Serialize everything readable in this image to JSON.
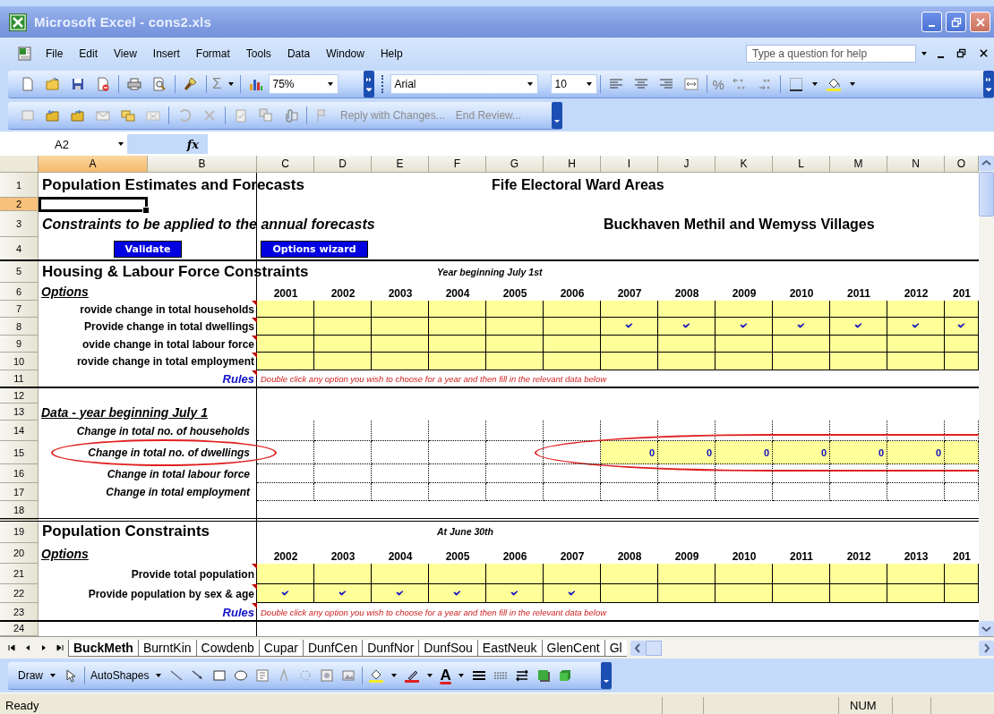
{
  "window": {
    "title": "Microsoft Excel - cons2.xls"
  },
  "menu": [
    "File",
    "Edit",
    "View",
    "Insert",
    "Format",
    "Tools",
    "Data",
    "Window",
    "Help"
  ],
  "help_box": {
    "placeholder": "Type a question for help"
  },
  "formatting": {
    "sum_glyph": "Σ",
    "zoom": "75%",
    "font": "Arial",
    "size": "10",
    "percent_glyph": "%"
  },
  "review_toolbar": [
    {
      "label": "Reply with Changes...",
      "disabled": true
    },
    {
      "label": "End Review...",
      "disabled": true
    }
  ],
  "formula_bar": {
    "name_box": "A2",
    "fx": "fx"
  },
  "columns": [
    {
      "label": "A",
      "selected": true
    },
    {
      "label": "B",
      "selected": false
    },
    {
      "label": "C",
      "selected": false
    },
    {
      "label": "D",
      "selected": false
    },
    {
      "label": "E",
      "selected": false
    },
    {
      "label": "F",
      "selected": false
    },
    {
      "label": "G",
      "selected": false
    },
    {
      "label": "H",
      "selected": false
    },
    {
      "label": "I",
      "selected": false
    },
    {
      "label": "J",
      "selected": false
    },
    {
      "label": "K",
      "selected": false
    },
    {
      "label": "L",
      "selected": false
    },
    {
      "label": "M",
      "selected": false
    },
    {
      "label": "N",
      "selected": false
    },
    {
      "label": "O",
      "selected": false
    }
  ],
  "rows": [
    {
      "n": "1",
      "selected": false,
      "items": [
        {
          "kind": "title",
          "text": "Population Estimates and Forecasts"
        },
        {
          "kind": "heading",
          "text": "Fife Electoral Ward Areas"
        }
      ]
    },
    {
      "n": "2",
      "selected": true
    },
    {
      "n": "3",
      "selected": false,
      "items": [
        {
          "kind": "subtitle",
          "text": "Constraints to be applied to the annual forecasts"
        },
        {
          "kind": "area",
          "text": "Buckhaven Methil and Wemyss Villages"
        }
      ]
    },
    {
      "n": "4",
      "selected": false,
      "rule_below": true,
      "items": [
        {
          "kind": "button",
          "text": "Validate"
        },
        {
          "kind": "button",
          "text": "Options wizard"
        }
      ]
    },
    {
      "n": "5",
      "selected": false,
      "items": [
        {
          "kind": "title",
          "text": "Housing & Labour Force Constraints"
        },
        {
          "kind": "note",
          "text": "Year beginning July 1st"
        }
      ]
    },
    {
      "n": "6",
      "selected": false,
      "items": [
        {
          "kind": "section",
          "text": "Options"
        }
      ],
      "years": [
        "2001",
        "2002",
        "2003",
        "2004",
        "2005",
        "2006",
        "2007",
        "2008",
        "2009",
        "2010",
        "2011",
        "2012",
        "201"
      ]
    },
    {
      "n": "7",
      "selected": false,
      "items": [
        {
          "kind": "label",
          "text": "rovide change in total households",
          "comment": true
        }
      ],
      "grid": {
        "kind": "input",
        "cells": [
          {
            "checked": false
          },
          {
            "checked": false
          },
          {
            "checked": false
          },
          {
            "checked": false
          },
          {
            "checked": false
          },
          {
            "checked": false
          },
          {
            "checked": false
          },
          {
            "checked": false
          },
          {
            "checked": false
          },
          {
            "checked": false
          },
          {
            "checked": false
          },
          {
            "checked": false
          },
          {
            "checked": false
          }
        ]
      }
    },
    {
      "n": "8",
      "selected": false,
      "items": [
        {
          "kind": "label",
          "text": "Provide change in total dwellings",
          "comment": true
        }
      ],
      "grid": {
        "kind": "input",
        "cells": [
          {
            "checked": false
          },
          {
            "checked": false
          },
          {
            "checked": false
          },
          {
            "checked": false
          },
          {
            "checked": false
          },
          {
            "checked": false
          },
          {
            "checked": true
          },
          {
            "checked": true
          },
          {
            "checked": true
          },
          {
            "checked": true
          },
          {
            "checked": true
          },
          {
            "checked": true
          },
          {
            "checked": true
          }
        ]
      }
    },
    {
      "n": "9",
      "selected": false,
      "items": [
        {
          "kind": "label",
          "text": "ovide change in total labour force",
          "comment": true
        }
      ],
      "grid": {
        "kind": "input",
        "cells": [
          {
            "checked": false
          },
          {
            "checked": false
          },
          {
            "checked": false
          },
          {
            "checked": false
          },
          {
            "checked": false
          },
          {
            "checked": false
          },
          {
            "checked": false
          },
          {
            "checked": false
          },
          {
            "checked": false
          },
          {
            "checked": false
          },
          {
            "checked": false
          },
          {
            "checked": false
          },
          {
            "checked": false
          }
        ]
      }
    },
    {
      "n": "10",
      "selected": false,
      "items": [
        {
          "kind": "label",
          "text": "rovide change in total employment",
          "comment": true
        }
      ],
      "grid": {
        "kind": "input",
        "cells": [
          {
            "checked": false
          },
          {
            "checked": false
          },
          {
            "checked": false
          },
          {
            "checked": false
          },
          {
            "checked": false
          },
          {
            "checked": false
          },
          {
            "checked": false
          },
          {
            "checked": false
          },
          {
            "checked": false
          },
          {
            "checked": false
          },
          {
            "checked": false
          },
          {
            "checked": false
          },
          {
            "checked": false
          }
        ]
      }
    },
    {
      "n": "11",
      "selected": false,
      "rule_below": true,
      "items": [
        {
          "kind": "rules",
          "text": "Rules",
          "comment": true
        },
        {
          "kind": "hint",
          "text": "Double click any option you wish to choose for a year and then fill in the relevant data below"
        }
      ]
    },
    {
      "n": "12",
      "selected": false
    },
    {
      "n": "13",
      "selected": false,
      "items": [
        {
          "kind": "section",
          "text": "Data - year beginning July 1"
        }
      ]
    },
    {
      "n": "14",
      "selected": false,
      "items": [
        {
          "kind": "data_label",
          "text": "Change in total no. of households"
        }
      ],
      "grid": {
        "kind": "data",
        "cells": [
          {
            "highlighted": false
          },
          {
            "highlighted": false
          },
          {
            "highlighted": false
          },
          {
            "highlighted": false
          },
          {
            "highlighted": false
          },
          {
            "highlighted": false
          },
          {
            "highlighted": false
          },
          {
            "highlighted": false
          },
          {
            "highlighted": false
          },
          {
            "highlighted": false
          },
          {
            "highlighted": false
          },
          {
            "highlighted": false
          },
          {
            "highlighted": false
          }
        ]
      }
    },
    {
      "n": "15",
      "selected": false,
      "items": [
        {
          "kind": "data_label",
          "text": "Change in total no. of dwellings",
          "circled": true
        }
      ],
      "grid": {
        "kind": "data",
        "circled": true,
        "cells": [
          {
            "highlighted": false
          },
          {
            "highlighted": false
          },
          {
            "highlighted": false
          },
          {
            "highlighted": false
          },
          {
            "highlighted": false
          },
          {
            "highlighted": false
          },
          {
            "highlighted": true,
            "value": "0"
          },
          {
            "highlighted": true,
            "value": "0"
          },
          {
            "highlighted": true,
            "value": "0"
          },
          {
            "highlighted": true,
            "value": "0"
          },
          {
            "highlighted": true,
            "value": "0"
          },
          {
            "highlighted": true,
            "value": "0"
          },
          {
            "highlighted": true
          }
        ]
      }
    },
    {
      "n": "16",
      "selected": false,
      "items": [
        {
          "kind": "data_label",
          "text": "Change in total labour force"
        }
      ],
      "grid": {
        "kind": "data",
        "cells": [
          {
            "highlighted": false
          },
          {
            "highlighted": false
          },
          {
            "highlighted": false
          },
          {
            "highlighted": false
          },
          {
            "highlighted": false
          },
          {
            "highlighted": false
          },
          {
            "highlighted": false
          },
          {
            "highlighted": false
          },
          {
            "highlighted": false
          },
          {
            "highlighted": false
          },
          {
            "highlighted": false
          },
          {
            "highlighted": false
          },
          {
            "highlighted": false
          }
        ]
      }
    },
    {
      "n": "17",
      "selected": false,
      "items": [
        {
          "kind": "data_label",
          "text": "Change in total employment"
        }
      ],
      "grid": {
        "kind": "data",
        "cells": [
          {
            "highlighted": false
          },
          {
            "highlighted": false
          },
          {
            "highlighted": false
          },
          {
            "highlighted": false
          },
          {
            "highlighted": false
          },
          {
            "highlighted": false
          },
          {
            "highlighted": false
          },
          {
            "highlighted": false
          },
          {
            "highlighted": false
          },
          {
            "highlighted": false
          },
          {
            "highlighted": false
          },
          {
            "highlighted": false
          },
          {
            "highlighted": false
          }
        ]
      }
    },
    {
      "n": "18",
      "selected": false,
      "double_rule_below": true
    },
    {
      "n": "19",
      "selected": false,
      "items": [
        {
          "kind": "title",
          "text": "Population Constraints"
        },
        {
          "kind": "note",
          "text": "At June 30th"
        }
      ]
    },
    {
      "n": "20",
      "selected": false,
      "items": [
        {
          "kind": "section",
          "text": "Options"
        }
      ],
      "years": [
        "2002",
        "2003",
        "2004",
        "2005",
        "2006",
        "2007",
        "2008",
        "2009",
        "2010",
        "2011",
        "2012",
        "2013",
        "201"
      ]
    },
    {
      "n": "21",
      "selected": false,
      "items": [
        {
          "kind": "label",
          "text": "Provide total population",
          "comment": true
        }
      ],
      "grid": {
        "kind": "input",
        "cells": [
          {
            "checked": false
          },
          {
            "checked": false
          },
          {
            "checked": false
          },
          {
            "checked": false
          },
          {
            "checked": false
          },
          {
            "checked": false
          },
          {
            "checked": false
          },
          {
            "checked": false
          },
          {
            "checked": false
          },
          {
            "checked": false
          },
          {
            "checked": false
          },
          {
            "checked": false
          },
          {
            "checked": false
          }
        ]
      }
    },
    {
      "n": "22",
      "selected": false,
      "items": [
        {
          "kind": "label",
          "text": "Provide population by sex & age",
          "comment": true
        }
      ],
      "grid": {
        "kind": "input",
        "cells": [
          {
            "checked": true
          },
          {
            "checked": true
          },
          {
            "checked": true
          },
          {
            "checked": true
          },
          {
            "checked": true
          },
          {
            "checked": true
          },
          {
            "checked": false
          },
          {
            "checked": false
          },
          {
            "checked": false
          },
          {
            "checked": false
          },
          {
            "checked": false
          },
          {
            "checked": false
          },
          {
            "checked": false
          }
        ]
      }
    },
    {
      "n": "23",
      "selected": false,
      "rule_below": true,
      "items": [
        {
          "kind": "rules",
          "text": "Rules",
          "comment": true
        },
        {
          "kind": "hint",
          "text": "Double click any option you wish to choose for a year and then fill in the relevant data below"
        }
      ]
    },
    {
      "n": "24",
      "selected": false
    }
  ],
  "sheet_tabs": [
    {
      "label": "BuckMeth",
      "selected": true
    },
    {
      "label": "BurntKin",
      "selected": false
    },
    {
      "label": "Cowdenb",
      "selected": false
    },
    {
      "label": "Cupar",
      "selected": false
    },
    {
      "label": "DunfCen",
      "selected": false
    },
    {
      "label": "DunfNor",
      "selected": false
    },
    {
      "label": "DunfSou",
      "selected": false
    },
    {
      "label": "EastNeuk",
      "selected": false
    },
    {
      "label": "GlenCent",
      "selected": false
    },
    {
      "label": "Gl",
      "selected": false
    }
  ],
  "draw_toolbar": {
    "draw": "Draw",
    "autoshapes": "AutoShapes",
    "font_color_glyph": "A"
  },
  "status_bar": {
    "text": "Ready",
    "indicator": "NUM"
  }
}
